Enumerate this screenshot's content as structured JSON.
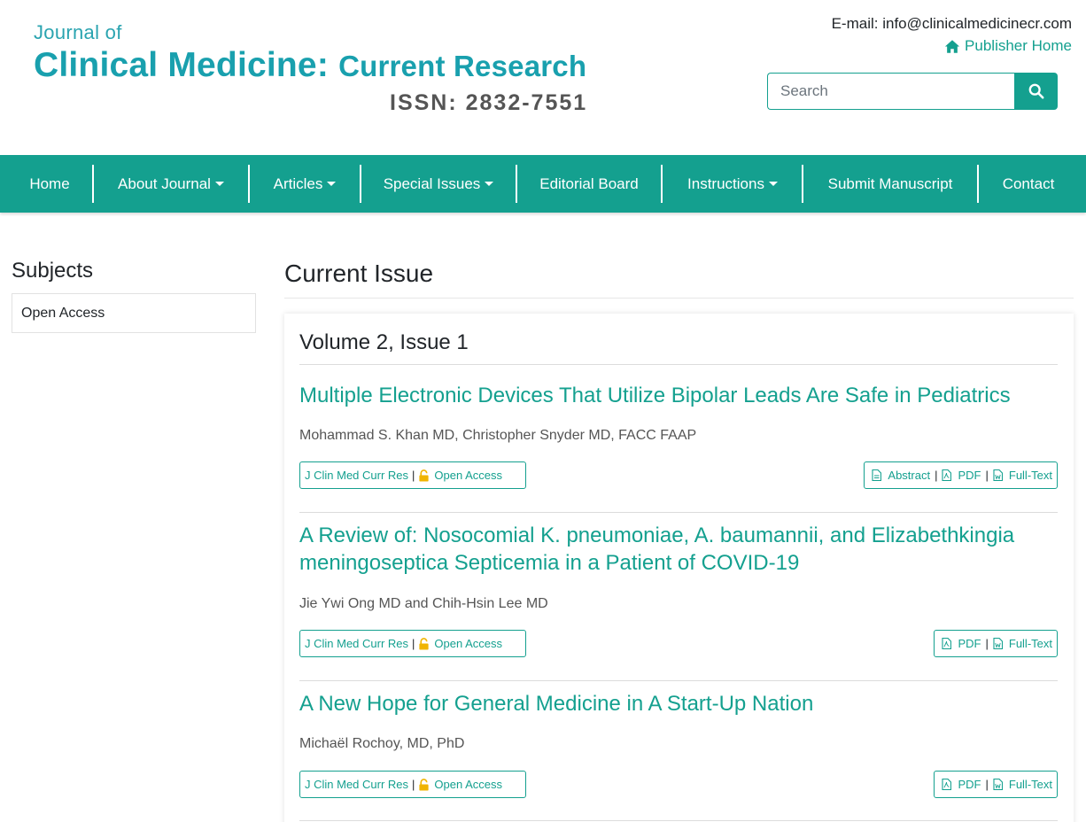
{
  "header": {
    "logo": {
      "line1": "Journal of",
      "title_main": "Clinical Medicine:",
      "title_sub": "Current Research",
      "issn": "ISSN:  2832-7551"
    },
    "email": "E-mail: info@clinicalmedicinecr.com",
    "publisher_home": "Publisher Home",
    "search": {
      "placeholder": "Search"
    }
  },
  "nav": {
    "items": [
      {
        "label": "Home",
        "dropdown": false
      },
      {
        "label": "About Journal",
        "dropdown": true
      },
      {
        "label": "Articles",
        "dropdown": true
      },
      {
        "label": "Special Issues",
        "dropdown": true
      },
      {
        "label": "Editorial Board",
        "dropdown": false
      },
      {
        "label": "Instructions",
        "dropdown": true
      },
      {
        "label": "Submit Manuscript",
        "dropdown": false
      },
      {
        "label": "Contact",
        "dropdown": false
      }
    ]
  },
  "sidebar": {
    "title": "Subjects",
    "items": [
      {
        "label": "Open Access"
      }
    ]
  },
  "main": {
    "title": "Current Issue",
    "volume": "Volume 2, Issue 1",
    "articles": [
      {
        "title": "Multiple Electronic Devices That Utilize Bipolar Leads Are Safe in Pediatrics",
        "authors": "Mohammad S. Khan MD, Christopher Snyder MD, FACC FAAP",
        "journal": "J Clin Med Curr Res",
        "access": "Open Access",
        "links": [
          "Abstract",
          "PDF",
          "Full-Text"
        ]
      },
      {
        "title": "A Review of: Nosocomial K. pneumoniae, A. baumannii, and Elizabethkingia meningoseptica Septicemia in a Patient of COVID-19",
        "authors": "Jie Ywi Ong MD and Chih-Hsin Lee MD",
        "journal": "J Clin Med Curr Res",
        "access": "Open Access",
        "links": [
          "PDF",
          "Full-Text"
        ]
      },
      {
        "title": "A New Hope for General Medicine in A Start-Up Nation",
        "authors": "Michaël Rochoy, MD, PhD",
        "journal": "J Clin Med Curr Res",
        "access": "Open Access",
        "links": [
          "PDF",
          "Full-Text"
        ]
      }
    ]
  },
  "colors": {
    "brand": "#14a08f",
    "logo": "#19a0ae",
    "lock": "#f0b400"
  },
  "icons": {
    "publisher": "home-icon",
    "search": "search-icon",
    "access": "lock-icon",
    "link": "document-icon"
  }
}
